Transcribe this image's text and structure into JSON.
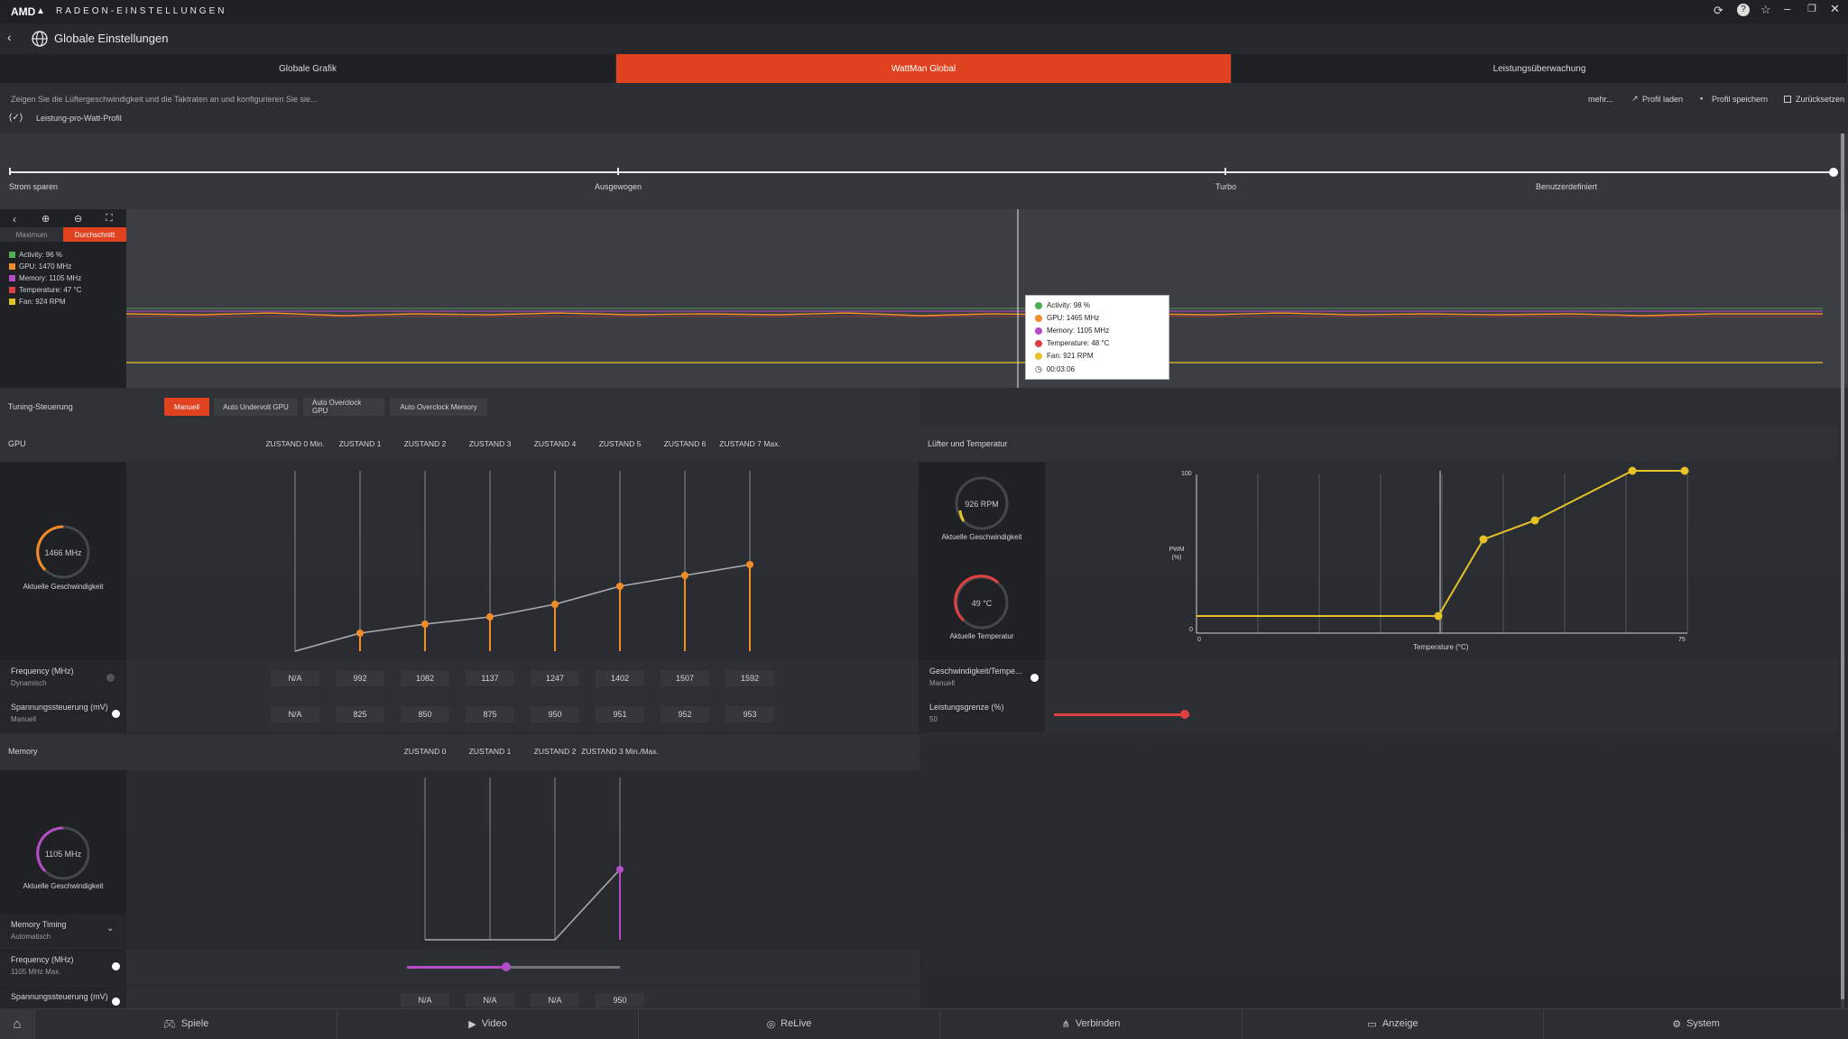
{
  "titlebar": {
    "brand": "AMD",
    "brand_mark": "▲",
    "app_title": "RADEON-EINSTELLUNGEN"
  },
  "appbar": {
    "title": "Globale Einstellungen"
  },
  "tabs": [
    {
      "label": "Globale Grafik"
    },
    {
      "label": "WattMan Global"
    },
    {
      "label": "Leistungsüberwachung"
    }
  ],
  "subbar": {
    "description": "Zeigen Sie die Lüftergeschwindigkeit und die Taktraten an und konfigurieren Sie sie...",
    "more": "mehr...",
    "load_profile": "Profil laden",
    "save_profile": "Profil speichern",
    "reset": "Zurücksetzen",
    "profile_name": "Leistung-pro-Watt-Profil"
  },
  "profiles": {
    "items": [
      "Strom sparen",
      "Ausgewogen",
      "Turbo",
      "Benutzerdefiniert"
    ]
  },
  "monitor": {
    "mode_max": "Maximum",
    "mode_avg": "Durchschnitt",
    "legend": [
      {
        "label": "Activity: 96 %",
        "color": "#4caf50"
      },
      {
        "label": "GPU: 1470 MHz",
        "color": "#f28c28"
      },
      {
        "label": "Memory: 1105 MHz",
        "color": "#b54cc7"
      },
      {
        "label": "Temperature: 47 °C",
        "color": "#e04040"
      },
      {
        "label": "Fan: 924 RPM",
        "color": "#e6c229"
      }
    ],
    "tooltip": [
      {
        "label": "Activity: 98 %",
        "color": "#4caf50"
      },
      {
        "label": "GPU: 1465 MHz",
        "color": "#f28c28"
      },
      {
        "label": "Memory: 1105 MHz",
        "color": "#b54cc7"
      },
      {
        "label": "Temperature: 48 °C",
        "color": "#e04040"
      },
      {
        "label": "Fan: 921 RPM",
        "color": "#e6c229"
      }
    ],
    "tooltip_time": "00:03:06"
  },
  "tuning": {
    "label": "Tuning-Steuerung",
    "buttons": [
      "Manuell",
      "Auto Undervolt GPU",
      "Auto Overclock GPU",
      "Auto Overclock Memory"
    ]
  },
  "gpu": {
    "label": "GPU",
    "gauge_value": "1466 MHz",
    "gauge_label": "Aktuelle Geschwindigkeit",
    "states": [
      "ZUSTAND 0 Min.",
      "ZUSTAND 1",
      "ZUSTAND 2",
      "ZUSTAND 3",
      "ZUSTAND 4",
      "ZUSTAND 5",
      "ZUSTAND 6",
      "ZUSTAND 7 Max."
    ],
    "freq_label": "Frequency (MHz)",
    "freq_mode": "Dynamisch",
    "freq_values": [
      "N/A",
      "992",
      "1082",
      "1137",
      "1247",
      "1402",
      "1507",
      "1592"
    ],
    "volt_label": "Spannungssteuerung (mV)",
    "volt_mode": "Manuell",
    "volt_values": [
      "N/A",
      "825",
      "850",
      "875",
      "950",
      "951",
      "952",
      "953"
    ]
  },
  "memory": {
    "label": "Memory",
    "gauge_value": "1105 MHz",
    "gauge_label": "Aktuelle Geschwindigkeit",
    "states": [
      "ZUSTAND 0",
      "ZUSTAND 1",
      "ZUSTAND 2",
      "ZUSTAND 3 Min./Max."
    ],
    "timing_label": "Memory Timing",
    "timing_mode": "Automatisch",
    "freq_label": "Frequency (MHz)",
    "freq_mode": "1105 MHz Max.",
    "volt_label": "Spannungssteuerung (mV)",
    "volt_values": [
      "N/A",
      "N/A",
      "N/A",
      "950"
    ]
  },
  "fan": {
    "label": "Lüfter und Temperatur",
    "fan_value": "926 RPM",
    "fan_label": "Aktuelle Geschwindigkeit",
    "temp_value": "49 °C",
    "temp_label": "Aktuelle Temperatur",
    "curve_ylabel": "PWM (%)",
    "curve_xlabel": "Temperature (°C)",
    "y_max": "100",
    "y_min": "0",
    "x_min": "0",
    "x_max": "75",
    "speed_temp_label": "Geschwindigkeit/Tempe...",
    "speed_temp_mode": "Manuell",
    "power_label": "Leistungsgrenze (%)",
    "power_value": "50"
  },
  "bottom": [
    "Spiele",
    "Video",
    "ReLive",
    "Verbinden",
    "Anzeige",
    "System"
  ]
}
